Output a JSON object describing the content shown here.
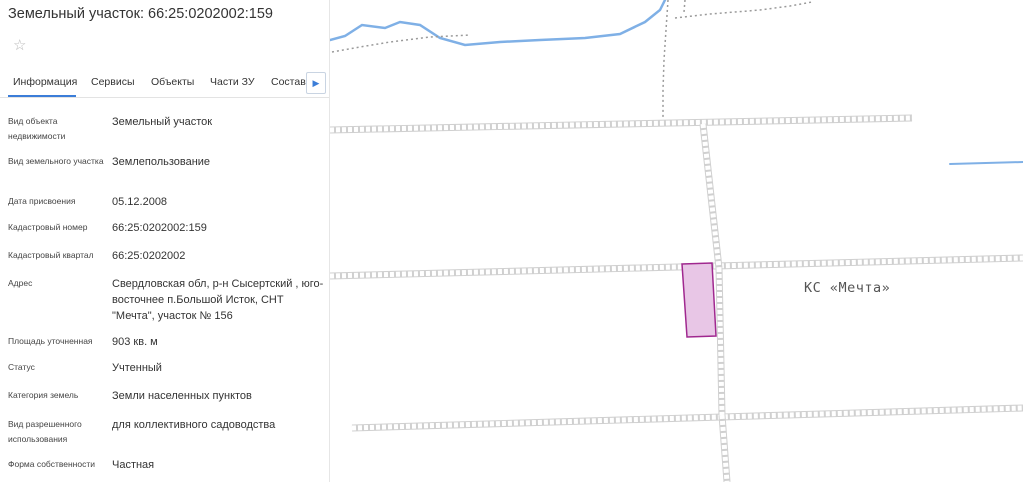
{
  "panel": {
    "title": "Земельный участок: 66:25:0202002:159",
    "favorite_icon": "star-icon",
    "tabs": [
      {
        "label": "Информация",
        "active": true
      },
      {
        "label": "Сервисы",
        "active": false
      },
      {
        "label": "Объекты",
        "active": false
      },
      {
        "label": "Части ЗУ",
        "active": false
      },
      {
        "label": "Состав",
        "active": false
      }
    ],
    "tabs_next_icon": "chevron-right-icon",
    "fields": [
      {
        "label": "Вид объекта недвижимости",
        "value": "Земельный участок"
      },
      {
        "label": "Вид земельного участка",
        "value": "Землепользование"
      },
      {
        "label": "Дата присвоения",
        "value": "05.12.2008"
      },
      {
        "label": "Кадастровый номер",
        "value": "66:25:0202002:159"
      },
      {
        "label": "Кадастровый квартал",
        "value": "66:25:0202002"
      },
      {
        "label": "Адрес",
        "value": "Свердловская обл, р-н Сысертский , юго-восточнее п.Большой Исток, СНТ \"Мечта\", участок № 156"
      },
      {
        "label": "Площадь уточненная",
        "value": "903 кв. м"
      },
      {
        "label": "Статус",
        "value": "Учтенный"
      },
      {
        "label": "Категория земель",
        "value": "Земли населенных пунктов"
      },
      {
        "label": "Вид разрешенного использования",
        "value": "для коллективного садоводства"
      },
      {
        "label": "Форма собственности",
        "value": "Частная"
      }
    ]
  },
  "map": {
    "area_label": "КС «Мечта»",
    "colors": {
      "parcel_fill": "#e8c6e6",
      "parcel_stroke": "#a0288f",
      "water": "#7fb0e6",
      "road_stroke": "#d0d0d0",
      "path": "#9a9a9a"
    }
  }
}
